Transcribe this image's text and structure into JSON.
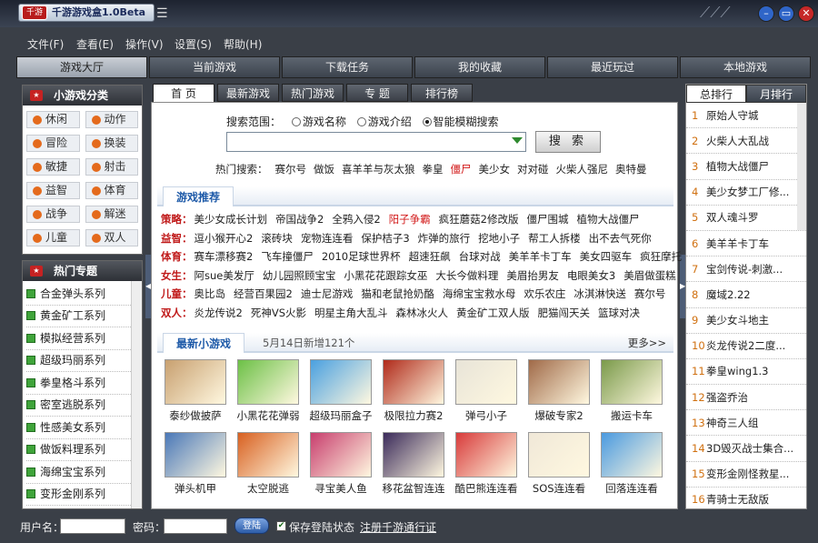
{
  "app": {
    "title": "千游游戏盒1.0Beta",
    "logo": "千游"
  },
  "window": {
    "min": "–",
    "max": "▭",
    "close": "✕"
  },
  "menu": [
    "文件(F)",
    "查看(E)",
    "操作(V)",
    "设置(S)",
    "帮助(H)"
  ],
  "nav": [
    "游戏大厅",
    "当前游戏",
    "下载任务",
    "我的收藏",
    "最近玩过",
    "本地游戏"
  ],
  "categories": {
    "title": "小游戏分类",
    "items": [
      "休闲",
      "动作",
      "冒险",
      "换装",
      "敏捷",
      "射击",
      "益智",
      "体育",
      "战争",
      "解迷",
      "儿童",
      "双人"
    ]
  },
  "hot": {
    "title": "热门专题",
    "items": [
      "合金弹头系列",
      "黄金矿工系列",
      "模拟经营系列",
      "超级玛丽系列",
      "拳皇格斗系列",
      "密室逃脱系列",
      "性感美女系列",
      "做饭料理系列",
      "海绵宝宝系列",
      "变形金刚系列"
    ]
  },
  "tabs": [
    "首 页",
    "最新游戏",
    "热门游戏",
    "专 题",
    "排行榜"
  ],
  "search": {
    "label": "搜索范围：",
    "opt1": "游戏名称",
    "opt2": "游戏介绍",
    "opt3": "智能模糊搜索",
    "button": "搜 索",
    "hot_label": "热门搜索：",
    "hot": [
      "赛尔号",
      "做饭",
      "喜羊羊与灰太狼",
      "拳皇",
      "僵尸",
      "美少女",
      "对对碰",
      "火柴人强尼",
      "奥特曼"
    ],
    "hot_highlight": "僵尸"
  },
  "recommend": {
    "title": "游戏推荐",
    "rows": [
      {
        "cat": "策略：",
        "games": [
          "美少女成长计划",
          "帝国战争2",
          "全鸦入侵2",
          "阳子争霸",
          "疯狂蘑菇2修改版",
          "僵尸围城",
          "植物大战僵尸"
        ],
        "hl": "阳子争霸"
      },
      {
        "cat": "益智：",
        "games": [
          "逗小猴开心2",
          "滚砖块",
          "宠物连连看",
          "保护桔子3",
          "炸弹的旅行",
          "挖地小子",
          "帮工人拆楼",
          "出不去气死你"
        ],
        "hl": ""
      },
      {
        "cat": "体育：",
        "games": [
          "赛车漂移赛2",
          "飞车撞僵尸",
          "2010足球世界杯",
          "超速狂飙",
          "台球对战",
          "美羊羊卡丁车",
          "美女四驱车",
          "疯狂摩托"
        ],
        "hl": ""
      },
      {
        "cat": "女生：",
        "games": [
          "阿sue美发厅",
          "幼儿园照顾宝宝",
          "小黑花花跟踪女巫",
          "大长今做料理",
          "美眉抬男友",
          "电眼美女3",
          "美眉做蛋糕"
        ],
        "hl": ""
      },
      {
        "cat": "儿童：",
        "games": [
          "奥比岛",
          "经营百果园2",
          "迪士尼游戏",
          "猫和老鼠抢奶酪",
          "海绵宝宝救水母",
          "欢乐农庄",
          "冰淇淋快送",
          "赛尔号"
        ],
        "hl": ""
      },
      {
        "cat": "双人：",
        "games": [
          "炎龙传说2",
          "死神VS火影",
          "明星主角大乱斗",
          "森林冰火人",
          "黄金矿工双人版",
          "肥猫闯天关",
          "篮球对决"
        ],
        "hl": ""
      }
    ]
  },
  "newgames": {
    "title": "最新小游戏",
    "date": "5月14日新增121个",
    "more": "更多>>",
    "items": [
      {
        "name": "泰纱做披萨",
        "color": "#c8a070"
      },
      {
        "name": "小黑花花弹弱",
        "color": "#6cc046"
      },
      {
        "name": "超级玛丽盒子",
        "color": "#4aa0e0"
      },
      {
        "name": "极限拉力赛2",
        "color": "#b02a1a"
      },
      {
        "name": "弹弓小子",
        "color": "#e8e4d8"
      },
      {
        "name": "爆破专家2",
        "color": "#a06a48"
      },
      {
        "name": "搬运卡车",
        "color": "#7a9a4a"
      },
      {
        "name": "弹头机甲",
        "color": "#4a78b8"
      },
      {
        "name": "太空脱逃",
        "color": "#d86020"
      },
      {
        "name": "寻宝美人鱼",
        "color": "#c83e6e"
      },
      {
        "name": "移花盆智连连",
        "color": "#3a2a5a"
      },
      {
        "name": "酷巴熊连连看",
        "color": "#d83a3a"
      },
      {
        "name": "SOS连连看",
        "color": "#f0e8d8"
      },
      {
        "name": "回落连连看",
        "color": "#4a9ae0"
      }
    ]
  },
  "ranking": {
    "tab1": "总排行",
    "tab2": "月排行",
    "items": [
      "原始人守城",
      "火柴人大乱战",
      "植物大战僵尸",
      "美少女梦工厂修...",
      "双人魂斗罗",
      "美羊羊卡丁车",
      "宝剑传说-刺激...",
      "魔域2.22",
      "美少女斗地主",
      "炎龙传说2二度...",
      "拳皇wing1.3",
      "强盗乔治",
      "神奇三人组",
      "3D毁灭战士集合...",
      "变形金刚怪救星...",
      "青骑士无敌版"
    ]
  },
  "login": {
    "user_label": "用户名：",
    "pwd_label": "密码：",
    "button": "登陆",
    "remember": "保存登陆状态",
    "register": "注册千游通行证"
  }
}
